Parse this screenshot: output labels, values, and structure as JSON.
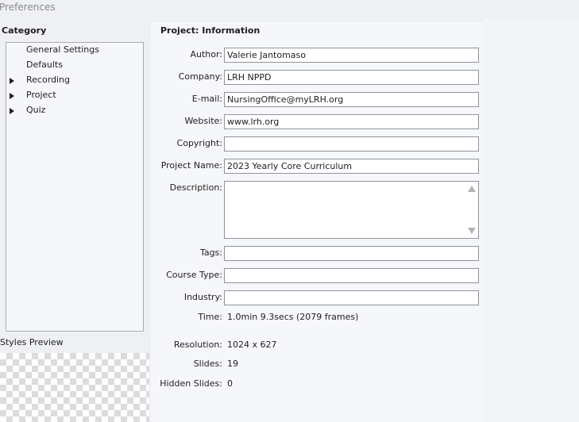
{
  "window": {
    "title": "Preferences"
  },
  "sidebar": {
    "category_label": "Category",
    "items": [
      {
        "label": "General Settings",
        "expandable": false
      },
      {
        "label": "Defaults",
        "expandable": false
      },
      {
        "label": "Recording",
        "expandable": true
      },
      {
        "label": "Project",
        "expandable": true
      },
      {
        "label": "Quiz",
        "expandable": true
      }
    ],
    "styles_preview_label": "Styles Preview"
  },
  "main": {
    "section_title": "Project: Information",
    "fields": {
      "author": {
        "label": "Author:",
        "value": "Valerie Jantomaso"
      },
      "company": {
        "label": "Company:",
        "value": "LRH NPPD"
      },
      "email": {
        "label": "E-mail:",
        "value": "NursingOffice@myLRH.org"
      },
      "website": {
        "label": "Website:",
        "value": "www.lrh.org"
      },
      "copyright": {
        "label": "Copyright:",
        "value": ""
      },
      "project_name": {
        "label": "Project Name:",
        "value": "2023 Yearly Core Curriculum"
      },
      "description": {
        "label": "Description:",
        "value": ""
      },
      "tags": {
        "label": "Tags:",
        "value": ""
      },
      "course_type": {
        "label": "Course Type:",
        "value": ""
      },
      "industry": {
        "label": "Industry:",
        "value": ""
      }
    },
    "info": {
      "time": {
        "label": "Time:",
        "value": "1.0min 9.3secs (2079 frames)"
      },
      "resolution": {
        "label": "Resolution:",
        "value": "1024 x 627"
      },
      "slides": {
        "label": "Slides:",
        "value": "19"
      },
      "hidden_slides": {
        "label": "Hidden Slides:",
        "value": "0"
      }
    }
  },
  "icons": {
    "expand": "triangle-right-icon",
    "scroll_up": "scroll-up-arrow-icon",
    "scroll_down": "scroll-down-arrow-icon"
  },
  "colors": {
    "window_bg": "#eef0f4",
    "panel_bg": "#f6f7fa",
    "input_border": "#8f939b",
    "tree_border": "#a9acb3"
  }
}
